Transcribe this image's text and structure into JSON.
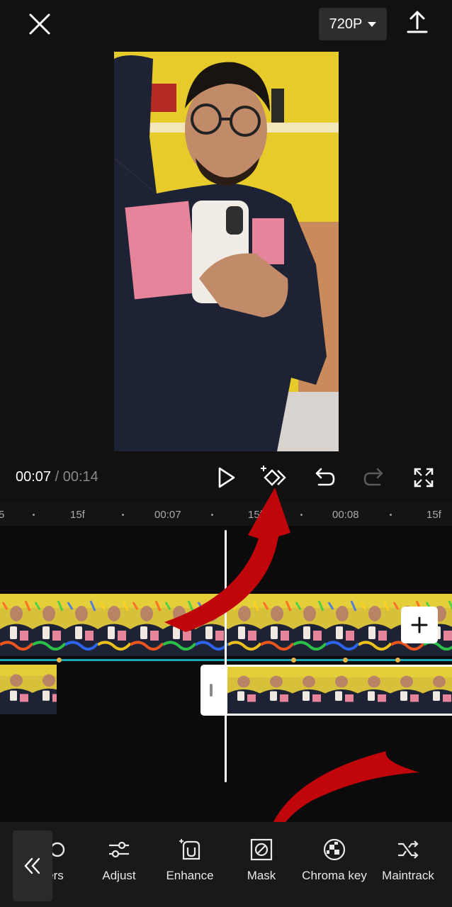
{
  "top_bar": {
    "resolution_label": "720P",
    "close_icon": "close-icon",
    "export_icon": "upload-icon"
  },
  "playback": {
    "current_time": "00:07",
    "separator": " / ",
    "total_time": "00:14",
    "controls": [
      "play-icon",
      "keyframe-icon",
      "undo-icon",
      "redo-icon",
      "fullscreen-icon"
    ]
  },
  "ruler": {
    "labels": [
      "5",
      "15f",
      "00:07",
      "15f",
      "00:08",
      "15f"
    ]
  },
  "toolbar": {
    "items": [
      {
        "label": "ers",
        "icon": "filters-icon"
      },
      {
        "label": "Adjust",
        "icon": "sliders-icon"
      },
      {
        "label": "Enhance",
        "icon": "enhance-icon"
      },
      {
        "label": "Mask",
        "icon": "mask-icon"
      },
      {
        "label": "Chroma key",
        "icon": "chroma-key-icon"
      },
      {
        "label": "Maintrack",
        "icon": "shuffle-icon"
      }
    ]
  },
  "colors": {
    "background": "#111111",
    "annotation_arrow": "#c0060b",
    "track_line": "#1aa3b5",
    "keyframe_dot": "#e7b54a"
  }
}
